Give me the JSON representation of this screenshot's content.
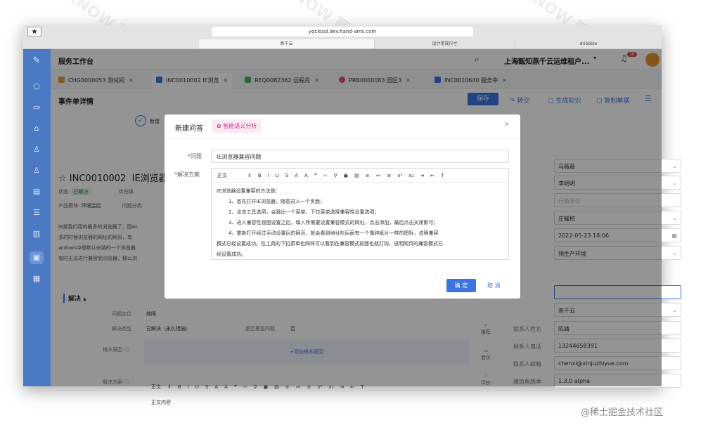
{
  "browser": {
    "url": "yqcloud.dev.hand-ams.com",
    "tabs": [
      "燕千云",
      "设计常规尺寸",
      "dribbble"
    ]
  },
  "topbar": {
    "title": "服务工作台",
    "tenant": "上海甄知燕千云运维租户...",
    "notif_count": "10"
  },
  "tabs": [
    {
      "label": "CHG0000053 测试间",
      "color": "#e59a2d"
    },
    {
      "label": "INC0010002 IE浏览",
      "color": "#3c74e2"
    },
    {
      "label": "REQ0082362 远程月",
      "color": "#4cb35a"
    },
    {
      "label": "PRB0000083 园区3",
      "color": "#e05060"
    },
    {
      "label": "INC0010640 服务中",
      "color": "#3c74e2"
    }
  ],
  "page": {
    "title": "事件单详情",
    "save": "保存",
    "transfer": "转交",
    "generate": "生成知识",
    "copy": "复制单据",
    "step": "新建"
  },
  "ticket": {
    "number": "INC0010002",
    "title": "IE浏览器兼",
    "status_label": "状态:",
    "status": "已解决",
    "priority_label": "优先级:",
    "module_label": "产品模块:",
    "module": "环境监控",
    "category_label": "问题分类:",
    "desc": [
      "IE是我们用的最多的浏览器了，因wi",
      "多的时候浏览器的网址的网页，有",
      "widows中是默认安装的一个浏览器",
      "有时无法进行兼容到浏览器，那么浏"
    ]
  },
  "solve": {
    "section": "解决",
    "locate_label": "问题定位",
    "locate": "故障",
    "type_label": "解决类型",
    "type": "已解决（永久措施）",
    "repeat_label": "是否重复问题",
    "repeat": "否",
    "root_label": "根本原因",
    "add_root": "+添加根本原因",
    "plan_label": "解决方案",
    "plan_font": "正文",
    "plan_body": "正文内容"
  },
  "right": {
    "assignee": "马薇薇",
    "owner": "李明明",
    "placeholder": "行政单位",
    "handler": "庄耀柏",
    "date": "2022-05-23 18:06",
    "env": "预生产环境",
    "org": "燕千云",
    "contact_name_label": "联系人姓名",
    "contact_name": "陈靖",
    "contact_phone_label": "联系人电话",
    "contact_phone": "13244658391",
    "contact_email_label": "联系人邮箱",
    "contact_email": "chenxi@xinjuzhiyue.com",
    "version_label": "猪齿鱼版本",
    "version": "1.3.0 alpha"
  },
  "sidetools": [
    "推荐",
    "会议",
    "评价"
  ],
  "modal": {
    "title": "新建问答",
    "ai_tag": "智能语义分析",
    "question_label": "*问题",
    "question": "IE浏览器兼容问题",
    "solution_label": "*解决方案",
    "toolbar_font": "正文",
    "lines": [
      "IE浏览器设置兼容的方法是：",
      "1、首先打开IE浏览器，随意进入一个页面；",
      "2、点击工具选项，会跳出一个菜单，下拉菜单选择兼容性设置选项；",
      "3、进入兼容性视图设置之后，填入所需要设置兼容模式的网址，点击添加，最后点击关闭即可；",
      "4、重新打开经过手动设置后的网页，就会看到地址栏后面有一个像碎纸片一样的图标，说明兼容",
      "模式已经设置成功。在工具的下拉菜单也同样可以看到在兼容模式前面也就打钩，说明网页的兼容模式已",
      "经设置成功。"
    ],
    "ok": "确 定",
    "cancel": "取 消"
  },
  "footer": "@稀土掘金技术社区",
  "watermark": "zKNOW 甄知科技"
}
